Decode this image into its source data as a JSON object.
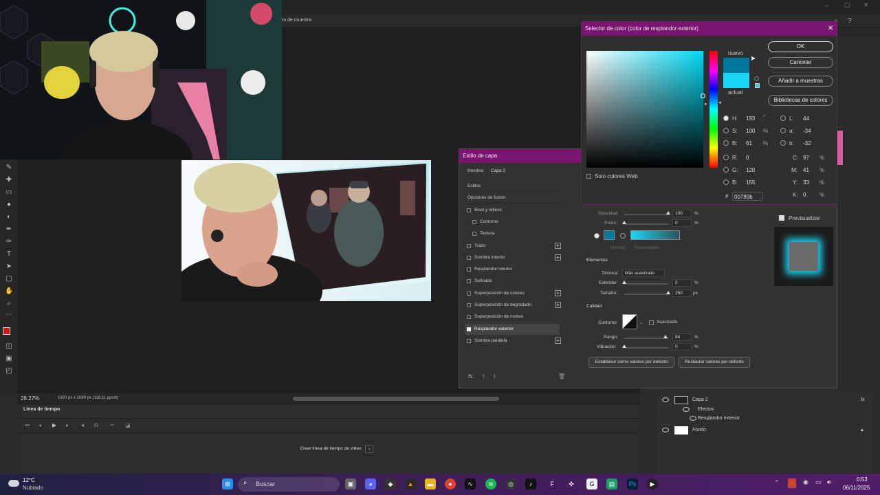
{
  "app": {
    "tab_title": "ro de muestra"
  },
  "status": {
    "zoom": "28.27%",
    "doc_info": "1920 px x 1080 px (118,11 ppcm)"
  },
  "timeline": {
    "tab": "Línea de tiempo",
    "create_button": "Crear línea de tiempo de vídeo"
  },
  "layer_style": {
    "title": "Estilo de capa",
    "name_label": "Nombre:",
    "name_value": "Capa 2",
    "items": [
      {
        "label": "Estilos",
        "check": false,
        "plus": false,
        "header": true
      },
      {
        "label": "Opciones de fusión",
        "check": false,
        "plus": false,
        "header": true
      },
      {
        "label": "Bisel y relieve",
        "check": true,
        "plus": false
      },
      {
        "label": "Contorno",
        "check": true,
        "plus": false,
        "indent": true
      },
      {
        "label": "Textura",
        "check": true,
        "plus": false,
        "indent": true
      },
      {
        "label": "Trazo",
        "check": true,
        "plus": true
      },
      {
        "label": "Sombra interior",
        "check": true,
        "plus": true
      },
      {
        "label": "Resplandor interior",
        "check": true,
        "plus": false
      },
      {
        "label": "Satinado",
        "check": true,
        "plus": false
      },
      {
        "label": "Superposición de colores",
        "check": true,
        "plus": true
      },
      {
        "label": "Superposición de degradado",
        "check": true,
        "plus": true
      },
      {
        "label": "Superposición de motivo",
        "check": true,
        "plus": false
      },
      {
        "label": "Resplandor exterior",
        "check": true,
        "plus": false,
        "checked": true,
        "selected": true
      },
      {
        "label": "Sombra paralela",
        "check": true,
        "plus": true
      }
    ],
    "opacity_label": "Opacidad:",
    "opacity_value": "100",
    "opacity_pct": 1.0,
    "noise_label": "Ruido:",
    "noise_value": "0",
    "noise_pct": 0,
    "method_label": "Método:",
    "method_value": "Redondeado",
    "elements_title": "Elementos",
    "technique_label": "Técnica:",
    "technique_value": "Más suavizado",
    "spread_label": "Extender:",
    "spread_value": "0",
    "spread_pct": 0,
    "size_label": "Tamaño:",
    "size_value": "250",
    "size_pct": 1.0,
    "quality_title": "Calidad",
    "contour_label": "Contorno:",
    "antialias_label": "Suavizado",
    "range_label": "Rango:",
    "range_value": "94",
    "range_pct": 0.94,
    "jitter_label": "Vibración:",
    "jitter_value": "0",
    "jitter_pct": 0,
    "default_set": "Establecer como valores por defecto",
    "default_reset": "Restaurar valores por defecto",
    "preview_label": "Previsualizar",
    "pct": "%",
    "px": "px"
  },
  "color_picker": {
    "title": "Selector de color (color de resplandor exterior)",
    "new_label": "nuevo",
    "current_label": "actual",
    "new_color": "#00789b",
    "current_color": "#1ad6f5",
    "ok": "OK",
    "cancel": "Cancelar",
    "add_swatches": "Añadir a muestras",
    "libraries": "Bibliotecas de colores",
    "web_only": "Solo colores Web",
    "H": "193",
    "S": "100",
    "Bv": "61",
    "R": "0",
    "G": "120",
    "Bb": "155",
    "L": "44",
    "a": "-34",
    "b": "-32",
    "C": "97",
    "M": "41",
    "Y": "33",
    "K": "0",
    "hex": "00789b",
    "labels": {
      "H": "H:",
      "S": "S:",
      "B": "B:",
      "R": "R:",
      "G": "G:",
      "Bb": "B:",
      "L": "L:",
      "a": "a:",
      "b": "b:",
      "C": "C:",
      "M": "M:",
      "Y": "Y:",
      "K": "K:",
      "hash": "#"
    },
    "units": {
      "deg": "°",
      "pct": "%"
    }
  },
  "layers": {
    "items": [
      {
        "name": "Capa 2"
      },
      {
        "name": "Efectos"
      },
      {
        "name": "Resplandor exterior"
      },
      {
        "name": "Fondo"
      }
    ]
  },
  "taskbar": {
    "weather_temp": "12°C",
    "weather_desc": "Nubiado",
    "search": "Buscar",
    "time": "0:53",
    "date": "06/11/2025"
  },
  "colors": {
    "accent": "#7a1572",
    "glow": "#1ad6f5",
    "foreground": "#e01010"
  }
}
